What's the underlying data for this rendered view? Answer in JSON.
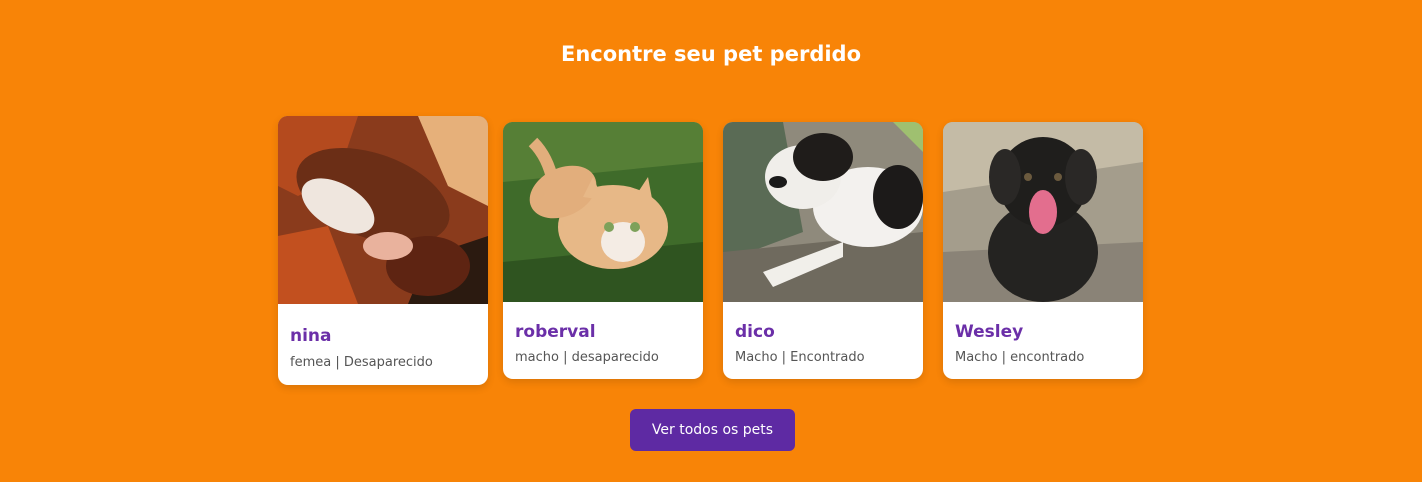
{
  "section": {
    "title": "Encontre seu pet perdido",
    "button_label": "Ver todos os pets"
  },
  "pets": [
    {
      "name": "nina",
      "meta": "femea | Desaparecido",
      "photo": "dog-photo"
    },
    {
      "name": "roberval",
      "meta": "macho | desaparecido",
      "photo": "cat-photo"
    },
    {
      "name": "dico",
      "meta": "Macho | Encontrado",
      "photo": "dog-photo"
    },
    {
      "name": "Wesley",
      "meta": "Macho | encontrado",
      "photo": "dog-photo"
    }
  ],
  "colors": {
    "background": "#f88407",
    "accent": "#5e2aa3",
    "name": "#6b2fa8",
    "card": "#ffffff"
  }
}
